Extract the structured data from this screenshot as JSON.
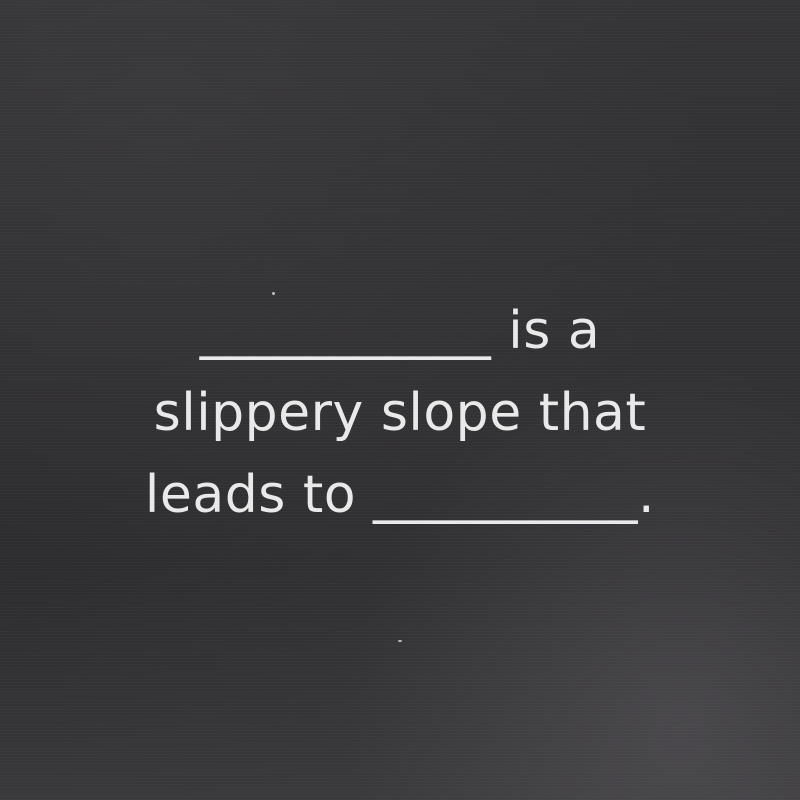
{
  "card": {
    "text": "___________ is a\nslippery slope that\nleads to __________."
  },
  "colors": {
    "background": "#2e2d30",
    "text": "#e9e9ea"
  }
}
